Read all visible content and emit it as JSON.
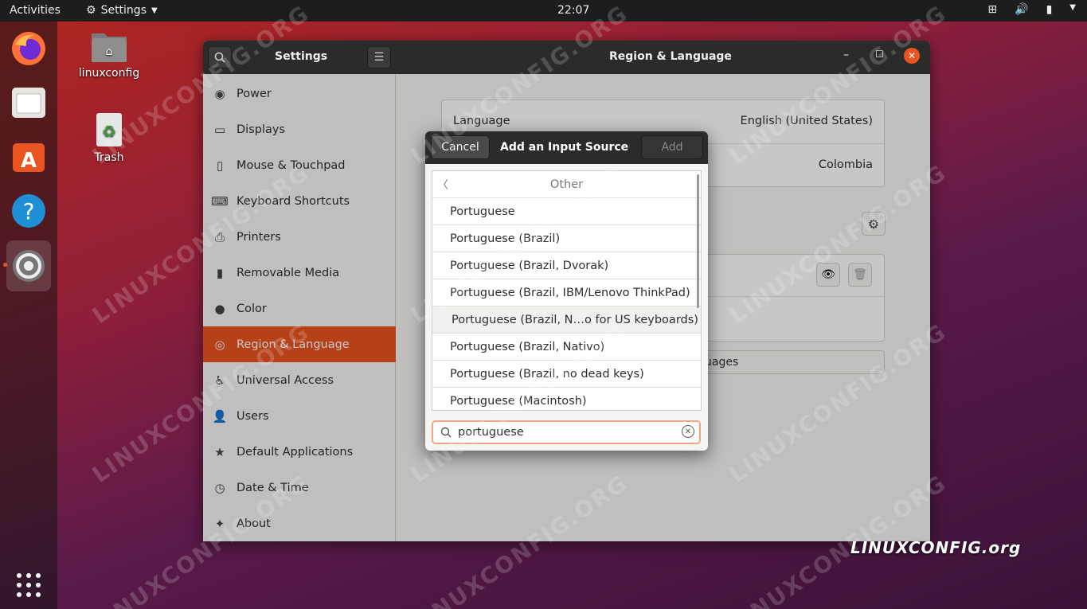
{
  "topbar": {
    "activities": "Activities",
    "app_menu": "Settings",
    "clock": "22:07"
  },
  "desktop": {
    "icons": [
      {
        "label": "linuxconfig"
      },
      {
        "label": "Trash"
      }
    ]
  },
  "window": {
    "sidebar_title": "Settings",
    "title": "Region & Language",
    "sidebar": [
      {
        "label": "Power",
        "icon": "power-icon"
      },
      {
        "label": "Displays",
        "icon": "display-icon"
      },
      {
        "label": "Mouse & Touchpad",
        "icon": "mouse-icon"
      },
      {
        "label": "Keyboard Shortcuts",
        "icon": "keyboard-icon"
      },
      {
        "label": "Printers",
        "icon": "printer-icon"
      },
      {
        "label": "Removable Media",
        "icon": "media-icon"
      },
      {
        "label": "Color",
        "icon": "color-icon"
      },
      {
        "label": "Region & Language",
        "icon": "globe-icon"
      },
      {
        "label": "Universal Access",
        "icon": "accessibility-icon"
      },
      {
        "label": "Users",
        "icon": "user-icon"
      },
      {
        "label": "Default Applications",
        "icon": "star-icon"
      },
      {
        "label": "Date & Time",
        "icon": "clock-icon"
      },
      {
        "label": "About",
        "icon": "sparkle-icon"
      }
    ],
    "main": {
      "language_label": "Language",
      "language_value": "English (United States)",
      "formats_value": "Colombia",
      "manage_button_tail": "uages"
    }
  },
  "dialog": {
    "cancel": "Cancel",
    "title": "Add an Input Source",
    "add": "Add",
    "back_label": "Other",
    "items": [
      "Portuguese",
      "Portuguese (Brazil)",
      "Portuguese (Brazil, Dvorak)",
      "Portuguese (Brazil, IBM/Lenovo ThinkPad)",
      "Portuguese (Brazil, N…o for US keyboards)",
      "Portuguese (Brazil, Nativo)",
      "Portuguese (Brazil, no dead keys)",
      "Portuguese (Macintosh)"
    ],
    "search_value": "portuguese"
  },
  "watermark": "LINUXCONFIG.ORG",
  "logo": "LINUXCONFIG.org",
  "colors": {
    "accent": "#e95420",
    "headerbar": "#2b2b2b"
  }
}
